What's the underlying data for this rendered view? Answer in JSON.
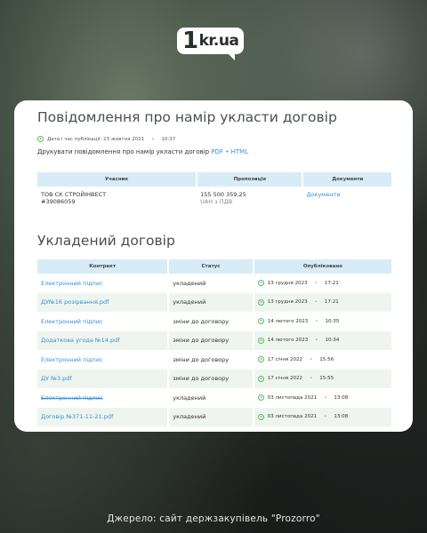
{
  "logo": {
    "one": "1",
    "text": "kr.ua"
  },
  "notice": {
    "title": "Повідомлення про намір укласти договір",
    "meta_label": "Дата і час публікації: 23 жовтня 2021",
    "meta_time": "10:37",
    "print_text": "Друкувати повідомлення про намір укласти договір",
    "pdf_link": "PDF",
    "separator": "•",
    "html_link": "HTML"
  },
  "participants_table": {
    "headers": [
      "Учасник",
      "Пропозиція",
      "Документи"
    ],
    "participant_name": "ТОВ СК СТРОЙІНВЕСТ",
    "participant_code": "#39086059",
    "offer_amount": "155 500 359,25",
    "offer_currency": "UAH з ПДВ",
    "documents_link": "Документи"
  },
  "contract": {
    "title": "Укладений договір",
    "headers": [
      "Контракт",
      "Статус",
      "Опубліковано"
    ],
    "rows": [
      {
        "name": "Електронний підпис",
        "status": "укладений",
        "date": "13 грудня 2023",
        "time": "17:21",
        "struck": false
      },
      {
        "name": "ДУ№16 розірвання.pdf",
        "status": "укладений",
        "date": "13 грудня 2023",
        "time": "17:21",
        "struck": false
      },
      {
        "name": "Електронний підпис",
        "status": "зміни до договору",
        "date": "14 лютого 2023",
        "time": "10:35",
        "struck": false
      },
      {
        "name": "Додаткова угода №14.pdf",
        "status": "зміни до договору",
        "date": "14 лютого 2023",
        "time": "10:34",
        "struck": false
      },
      {
        "name": "Електронний підпис",
        "status": "зміни до договору",
        "date": "17 січня 2022",
        "time": "15:56",
        "struck": false
      },
      {
        "name": "ДУ №3.pdf",
        "status": "зміни до договору",
        "date": "17 січня 2022",
        "time": "15:55",
        "struck": false
      },
      {
        "name": "Електронний підпис",
        "status": "укладений",
        "date": "03 листопада 2021",
        "time": "13:08",
        "struck": true
      },
      {
        "name": "Договір №371-11-21.pdf",
        "status": "укладений",
        "date": "03 листопада 2021",
        "time": "13:08",
        "struck": false
      }
    ]
  },
  "footer": {
    "source": "Джерело: сайт держзакупівель \"Prozorro\""
  },
  "colors": {
    "link": "#3a8fd6",
    "header_bg": "#d7ecf6",
    "row_alt": "#eef5ee",
    "clock": "#5cb85c"
  }
}
